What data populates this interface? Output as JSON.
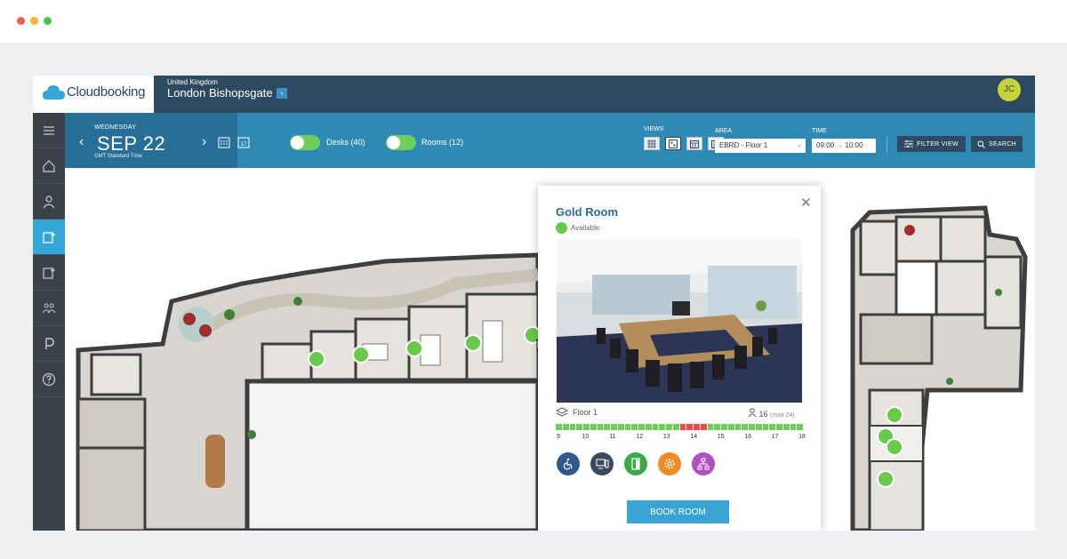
{
  "window": {
    "dots": [
      "#ef5b51",
      "#f5b731",
      "#4cc246"
    ]
  },
  "brand": {
    "name": "Cloudbooking",
    "color": "#2f4556"
  },
  "location": {
    "country": "United Kingdom",
    "site": "London Bishopsgate"
  },
  "user": {
    "initials": "JC"
  },
  "date": {
    "weekday": "WEDNESDAY",
    "display": "SEP 22",
    "timezone": "GMT Standard Time"
  },
  "filters": [
    {
      "label": "Desks (40)",
      "on": true
    },
    {
      "label": "Rooms (12)",
      "on": true
    }
  ],
  "views": {
    "label": "VIEWS",
    "items": [
      "grid-view",
      "map-view",
      "calendar-view",
      "schedule-view"
    ],
    "active": "map-view"
  },
  "area": {
    "label": "AREA",
    "value": "EBRD - Floor 1"
  },
  "time": {
    "label": "TIME",
    "start": "09:00",
    "arrow": "→",
    "end": "10:00"
  },
  "buttons": {
    "filter_view": "FILTER VIEW",
    "search": "SEARCH"
  },
  "sidebar": {
    "items": [
      "home",
      "profile",
      "book-room",
      "book-desk",
      "visitors",
      "parking",
      "help"
    ],
    "active": "book-room"
  },
  "room": {
    "name": "Gold Room",
    "status": "Available",
    "floor": "Floor 1",
    "capacity": "16",
    "capacity_max": "(max 24)",
    "hours": [
      "9",
      "10",
      "11",
      "12",
      "13",
      "14",
      "15",
      "16",
      "17",
      "18"
    ],
    "availability": [
      "free",
      "free",
      "free",
      "free",
      "free",
      "free",
      "free",
      "free",
      "free",
      "free",
      "free",
      "free",
      "free",
      "free",
      "free",
      "free",
      "free",
      "free",
      "booked",
      "booked",
      "booked",
      "booked",
      "free",
      "free",
      "free",
      "free",
      "free",
      "free",
      "free",
      "free",
      "free",
      "free",
      "free",
      "free",
      "free",
      "free"
    ],
    "amenities": [
      {
        "name": "accessible-icon",
        "color": "#2e5a8f"
      },
      {
        "name": "video-conference-icon",
        "color": "#3b4a5a"
      },
      {
        "name": "door-icon",
        "color": "#3aaa48"
      },
      {
        "name": "settings-icon",
        "color": "#f08a24"
      },
      {
        "name": "network-icon",
        "color": "#b14fc4"
      }
    ],
    "book_label": "BOOK ROOM"
  },
  "colors": {
    "free": "#6bcf5a",
    "booked": "#ef4a4a",
    "accent": "#35a7d6"
  }
}
